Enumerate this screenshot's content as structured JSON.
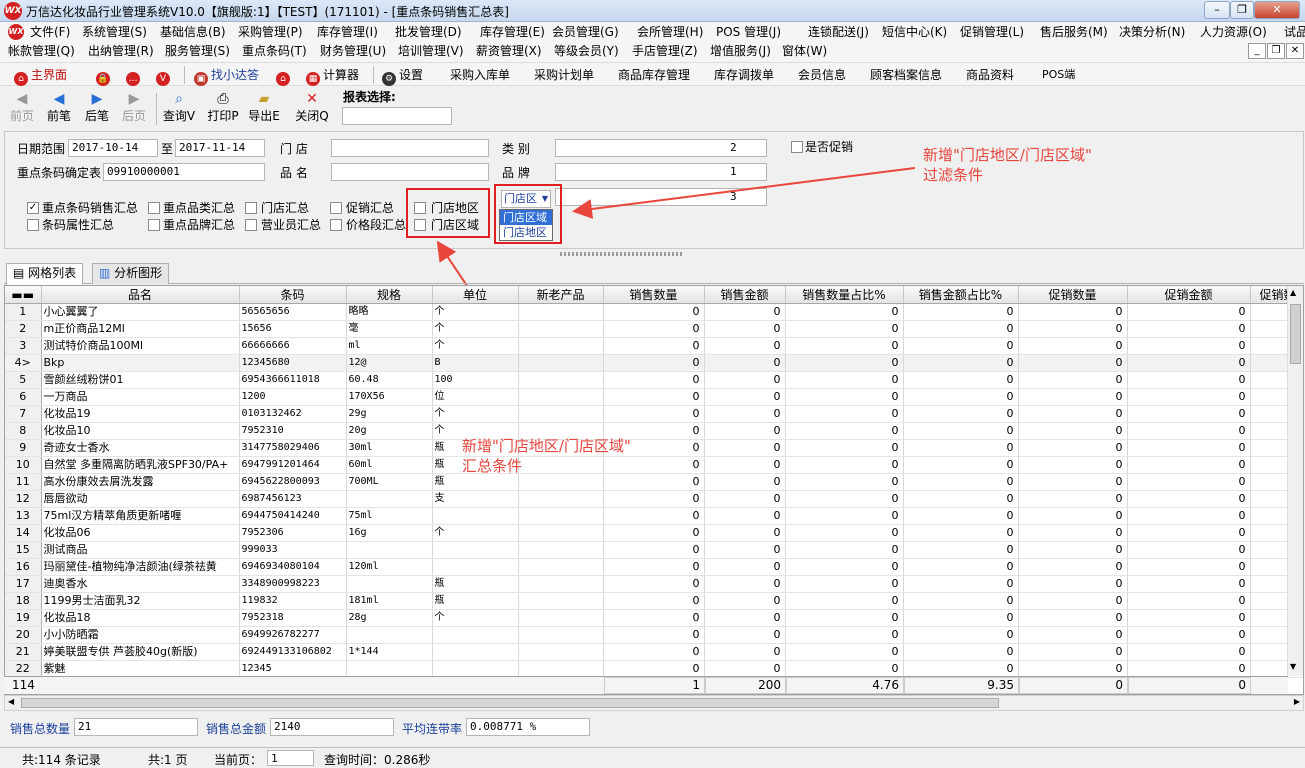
{
  "window": {
    "title": "万信达化妆品行业管理系统V10.0【旗舰版:1】【TEST】(171101) - [重点条码销售汇总表]",
    "logo_text": "WX"
  },
  "menu": {
    "row1": [
      "文件(F)",
      "系统管理(S)",
      "基础信息(B)",
      "采购管理(P)",
      "库存管理(I)",
      "批发管理(D)",
      "库存管理(E)",
      "会员管理(G)",
      "会所管理(H)",
      "POS 管理(J)",
      "连锁配送(J)",
      "短信中心(K)",
      "促销管理(L)",
      "售后服务(M)",
      "决策分析(N)",
      "人力资源(O)",
      "试品管理(P)"
    ],
    "row2": [
      "帐款管理(Q)",
      "出纳管理(R)",
      "服务管理(S)",
      "重点条码(T)",
      "财务管理(U)",
      "培训管理(V)",
      "薪资管理(X)",
      "等级会员(Y)",
      "手店管理(Z)",
      "增值服务(J)",
      "窗体(W)"
    ]
  },
  "toolbar1": {
    "items": [
      "主界面",
      "找小达答",
      "计算器",
      "设置",
      "采购入库单",
      "采购计划单",
      "商品库存管理",
      "库存调拨单",
      "会员信息",
      "顾客档案信息",
      "商品资料",
      "POS端"
    ]
  },
  "toolbar2": {
    "buttons": [
      "前页",
      "前笔",
      "后笔",
      "后页",
      "查询V",
      "打印P",
      "导出E",
      "关闭Q"
    ],
    "report_select_label": "报表选择:"
  },
  "filter": {
    "date_label": "日期范围",
    "date_from": "2017-10-14",
    "to_label": "至",
    "date_to": "2017-11-14",
    "store_label": "门      店",
    "category_label": "类      别",
    "category_value": "2",
    "promo_label": "是否促销",
    "barcode_label": "重点条码确定表",
    "barcode_value": "09910000001",
    "product_label": "品      名",
    "brand_label": "品      牌",
    "brand_value": "1",
    "third_value": "3",
    "checks": [
      {
        "label": "重点条码销售汇总",
        "checked": true
      },
      {
        "label": "重点品类汇总",
        "checked": false
      },
      {
        "label": "门店汇总",
        "checked": false
      },
      {
        "label": "促销汇总",
        "checked": false
      },
      {
        "label": "门店地区",
        "checked": false
      },
      {
        "label": "条码属性汇总",
        "checked": false
      },
      {
        "label": "重点品牌汇总",
        "checked": false
      },
      {
        "label": "营业员汇总",
        "checked": false
      },
      {
        "label": "价格段汇总",
        "checked": false
      },
      {
        "label": "门店区域",
        "checked": false
      }
    ],
    "combo_value": "门店区",
    "dropdown_options": [
      "门店区域",
      "门店地区"
    ]
  },
  "annotations": {
    "filter_note": "新增\"门店地区/门店区域\"\n过滤条件",
    "summary_note": "新增\"门店地区/门店区域\"\n汇总条件"
  },
  "tabs": [
    "网格列表",
    "分析图形"
  ],
  "grid": {
    "columns": [
      "",
      "品名",
      "条码",
      "规格",
      "单位",
      "新老产品",
      "销售数量",
      "销售金额",
      "销售数量占比%",
      "销售金额占比%",
      "促销数量",
      "促销金额",
      "促销数"
    ],
    "rows": [
      [
        "1",
        "小心翼翼了",
        "56565656",
        "略略",
        "个",
        "",
        "0",
        "0",
        "0",
        "0",
        "0",
        "0"
      ],
      [
        "2",
        "m正价商品12Ml",
        "15656",
        "毫",
        "个",
        "",
        "0",
        "0",
        "0",
        "0",
        "0",
        "0"
      ],
      [
        "3",
        "测试特价商品100Ml",
        "66666666",
        "ml",
        "个",
        "",
        "0",
        "0",
        "0",
        "0",
        "0",
        "0"
      ],
      [
        "4>",
        "Bkp",
        "12345680",
        "12@",
        "B",
        "",
        "0",
        "0",
        "0",
        "0",
        "0",
        "0"
      ],
      [
        "5",
        "雪颜丝绒粉饼01",
        "6954366611018",
        "60.48",
        "100",
        "",
        "0",
        "0",
        "0",
        "0",
        "0",
        "0"
      ],
      [
        "6",
        "一万商品",
        "1200",
        "170X56",
        "位",
        "",
        "0",
        "0",
        "0",
        "0",
        "0",
        "0"
      ],
      [
        "7",
        "化妆品19",
        "0103132462",
        "29g",
        "个",
        "",
        "0",
        "0",
        "0",
        "0",
        "0",
        "0"
      ],
      [
        "8",
        "化妆品10",
        "7952310",
        "20g",
        "个",
        "",
        "0",
        "0",
        "0",
        "0",
        "0",
        "0"
      ],
      [
        "9",
        "奇迹女士香水",
        "3147758029406",
        "30ml",
        "瓶",
        "",
        "0",
        "0",
        "0",
        "0",
        "0",
        "0"
      ],
      [
        "10",
        "自然堂 多重隔离防晒乳液SPF30/PA+",
        "6947991201464",
        "60ml",
        "瓶",
        "",
        "0",
        "0",
        "0",
        "0",
        "0",
        "0"
      ],
      [
        "11",
        "高水份康效去屑洗发露",
        "6945622800093",
        "700ML",
        "瓶",
        "",
        "0",
        "0",
        "0",
        "0",
        "0",
        "0"
      ],
      [
        "12",
        "唇唇欲动",
        "6987456123",
        "",
        "支",
        "",
        "0",
        "0",
        "0",
        "0",
        "0",
        "0"
      ],
      [
        "13",
        "75ml汉方精萃角质更新啫喱",
        "6944750414240",
        "75ml",
        "",
        "",
        "0",
        "0",
        "0",
        "0",
        "0",
        "0"
      ],
      [
        "14",
        "化妆品06",
        "7952306",
        "16g",
        "个",
        "",
        "0",
        "0",
        "0",
        "0",
        "0",
        "0"
      ],
      [
        "15",
        "测试商品",
        "999033",
        "",
        "",
        "",
        "0",
        "0",
        "0",
        "0",
        "0",
        "0"
      ],
      [
        "16",
        "玛丽黛佳-植物纯净洁颜油(绿茶祛黄",
        "6946934080104",
        "120ml",
        "",
        "",
        "0",
        "0",
        "0",
        "0",
        "0",
        "0"
      ],
      [
        "17",
        "迪奥香水",
        "3348900998223",
        "",
        "瓶",
        "",
        "0",
        "0",
        "0",
        "0",
        "0",
        "0"
      ],
      [
        "18",
        "1199男士洁面乳32",
        "119832",
        "181ml",
        "瓶",
        "",
        "0",
        "0",
        "0",
        "0",
        "0",
        "0"
      ],
      [
        "19",
        "化妆品18",
        "7952318",
        "28g",
        "个",
        "",
        "0",
        "0",
        "0",
        "0",
        "0",
        "0"
      ],
      [
        "20",
        "小小防晒霜",
        "6949926782277",
        "",
        "",
        "",
        "0",
        "0",
        "0",
        "0",
        "0",
        "0"
      ],
      [
        "21",
        "婷美联盟专供 芦荟胶40g(新版)",
        "692449133106802",
        "1*144",
        "",
        "",
        "0",
        "0",
        "0",
        "0",
        "0",
        "0"
      ],
      [
        "22",
        "紫魅",
        "12345",
        "",
        "",
        "",
        "0",
        "0",
        "0",
        "0",
        "0",
        "0"
      ]
    ],
    "footer": {
      "count": "114",
      "qty": "1",
      "amount": "200",
      "qty_pct": "4.76",
      "amt_pct": "9.35",
      "promo_qty": "0",
      "promo_amt": "0"
    }
  },
  "summary": {
    "qty_label": "销售总数量",
    "qty_value": "21",
    "amount_label": "销售总金额",
    "amount_value": "2140",
    "rate_label": "平均连带率",
    "rate_value": "0.008771 %"
  },
  "status": {
    "records": "共:114 条记录",
    "pages": "共:1 页",
    "current_label": "当前页：",
    "current_value": "1",
    "query_time": "查询时间：0.286秒"
  },
  "colors": {
    "accent": "#d42020",
    "annotation": "#e8453c",
    "summary_label": "#1a3f9c",
    "selection": "#2f6fd6"
  }
}
